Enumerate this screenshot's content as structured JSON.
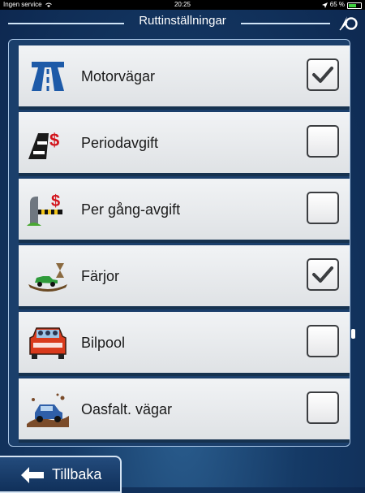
{
  "status_bar": {
    "carrier": "Ingen service",
    "time": "20:25",
    "battery_percent": "65 %",
    "battery_level": 0.65
  },
  "header": {
    "title": "Ruttinställningar"
  },
  "options": [
    {
      "label": "Motorvägar",
      "icon": "highway-icon",
      "checked": true
    },
    {
      "label": "Periodavgift",
      "icon": "toll-road-icon",
      "checked": false
    },
    {
      "label": "Per gång-avgift",
      "icon": "toll-gate-icon",
      "checked": false
    },
    {
      "label": "Färjor",
      "icon": "ferry-icon",
      "checked": true
    },
    {
      "label": "Bilpool",
      "icon": "carpool-icon",
      "checked": false
    },
    {
      "label": "Oasfalt. vägar",
      "icon": "unpaved-road-icon",
      "checked": false
    }
  ],
  "footer": {
    "back_label": "Tillbaka"
  },
  "colors": {
    "panel_bg": "#1b3f6b",
    "row_bg": "#e8eaec",
    "accent": "#cfe4f7",
    "check": "#3b3d40"
  }
}
